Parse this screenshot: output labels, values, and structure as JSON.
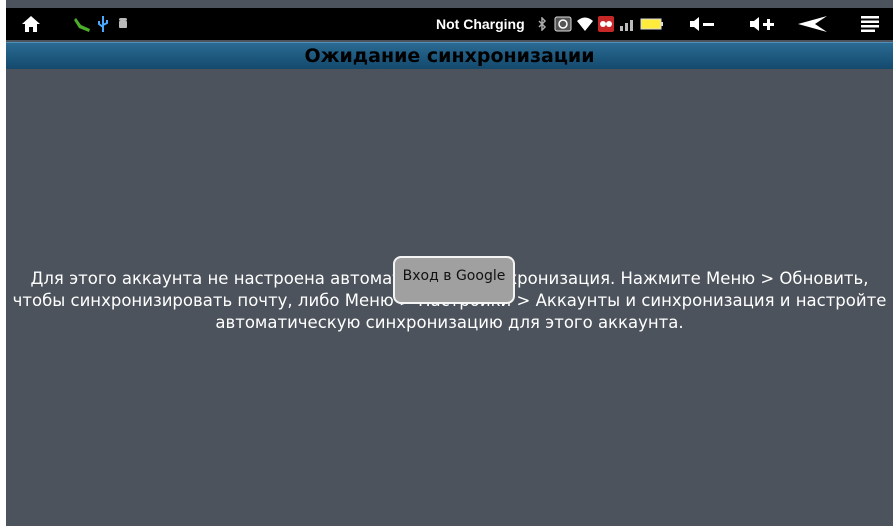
{
  "status_bar": {
    "charging_text": "Not Charging",
    "icons": [
      "home-icon",
      "usb-debug-icon",
      "usb-icon",
      "android-icon",
      "bluetooth-icon",
      "sync-icon",
      "wifi-icon",
      "alert-icon",
      "signal-icon",
      "battery-icon",
      "volume-down-icon",
      "volume-up-icon",
      "back-icon",
      "menu-icon"
    ]
  },
  "title": "Ожидание синхронизации",
  "message": "Для этого аккаунта не настроена автоматическая синхронизация. Нажмите Меню > Обновить, чтобы синхронизировать почту, либо Меню > Настройки > Аккаунты и синхронизация и настройте автоматическую синхронизацию для этого аккаунта.",
  "toast": "Вход в Google",
  "colors": {
    "background": "#4c535c",
    "titlebar": "#1e5a82",
    "statusbar": "#000000"
  }
}
